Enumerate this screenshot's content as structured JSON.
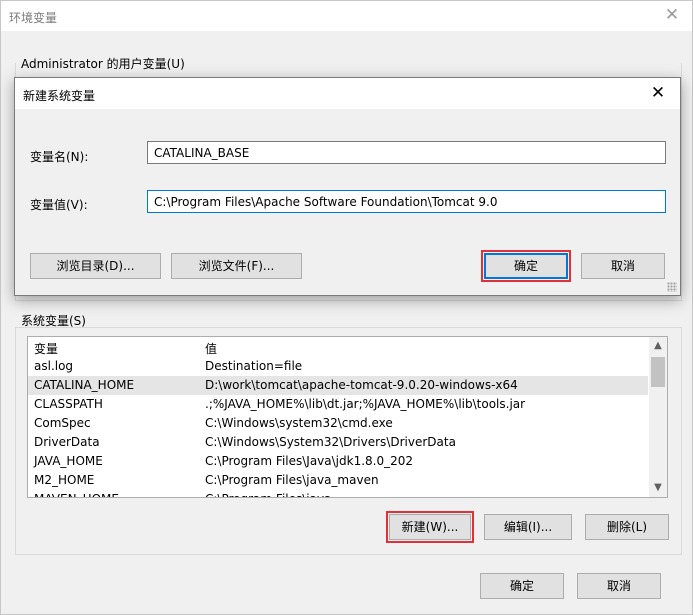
{
  "outer": {
    "title": "环境变量",
    "close_glyph": "✕",
    "user_vars_label": "Administrator 的用户变量(U)",
    "system_vars_label": "系统变量(S)",
    "list": {
      "columns": [
        "变量",
        "值"
      ],
      "rows": [
        {
          "name": "asl.log",
          "value": "Destination=file",
          "selected": false
        },
        {
          "name": "CATALINA_HOME",
          "value": "D:\\work\\tomcat\\apache-tomcat-9.0.20-windows-x64",
          "selected": true
        },
        {
          "name": "CLASSPATH",
          "value": ".;%JAVA_HOME%\\lib\\dt.jar;%JAVA_HOME%\\lib\\tools.jar",
          "selected": false
        },
        {
          "name": "ComSpec",
          "value": "C:\\Windows\\system32\\cmd.exe",
          "selected": false
        },
        {
          "name": "DriverData",
          "value": "C:\\Windows\\System32\\Drivers\\DriverData",
          "selected": false
        },
        {
          "name": "JAVA_HOME",
          "value": "C:\\Program Files\\Java\\jdk1.8.0_202",
          "selected": false
        },
        {
          "name": "M2_HOME",
          "value": "C:\\Program Files\\java_maven",
          "selected": false
        },
        {
          "name": "MAVEN_HOME",
          "value": "C:\\Program Files\\java...",
          "selected": false
        }
      ]
    },
    "buttons": {
      "new": "新建(W)...",
      "edit": "编辑(I)...",
      "delete": "删除(L)",
      "ok": "确定",
      "cancel": "取消"
    }
  },
  "dialog": {
    "title": "新建系统变量",
    "close_glyph": "✕",
    "name_label": "变量名(N):",
    "name_value": "CATALINA_BASE",
    "value_label": "变量值(V):",
    "value_value": "C:\\Program Files\\Apache Software Foundation\\Tomcat 9.0",
    "buttons": {
      "browse_dir": "浏览目录(D)...",
      "browse_file": "浏览文件(F)...",
      "ok": "确定",
      "cancel": "取消"
    }
  },
  "colors": {
    "highlight": "#e0313a",
    "accent": "#0078d7",
    "selected_row": "#e5e5e5"
  }
}
